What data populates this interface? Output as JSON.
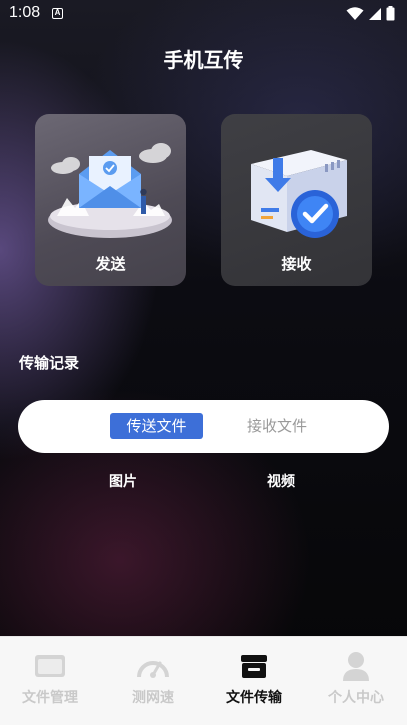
{
  "status_bar": {
    "time": "1:08",
    "notification_icon_label": "A"
  },
  "header": {
    "title": "手机互传"
  },
  "actions": {
    "send": {
      "label": "发送",
      "icon": "envelope-send-illustration"
    },
    "receive": {
      "label": "接收",
      "icon": "box-receive-illustration"
    }
  },
  "history": {
    "title": "传输记录",
    "tabs": [
      {
        "label": "传送文件",
        "active": true
      },
      {
        "label": "接收文件",
        "active": false
      }
    ],
    "categories": [
      "图片",
      "视频"
    ]
  },
  "bottom_nav": [
    {
      "label": "文件管理",
      "icon": "folder-icon",
      "active": false
    },
    {
      "label": "测网速",
      "icon": "speedometer-icon",
      "active": false
    },
    {
      "label": "文件传输",
      "icon": "file-box-icon",
      "active": true
    },
    {
      "label": "个人中心",
      "icon": "user-icon",
      "active": false
    }
  ],
  "colors": {
    "accent": "#3d6fd8",
    "inactive_nav": "#c9c9c9",
    "active_nav": "#111111"
  }
}
